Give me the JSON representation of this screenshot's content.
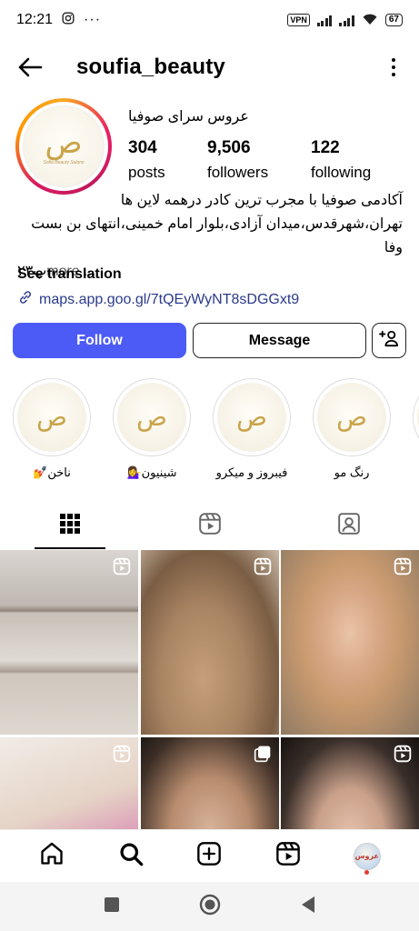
{
  "status_bar": {
    "time": "12:21",
    "vpn": "VPN",
    "battery": "67",
    "dots": "···"
  },
  "header": {
    "username": "soufia_beauty"
  },
  "profile": {
    "display_name": "عروس سرای صوفیا",
    "logo_text": "Sofia Beauty Salons",
    "stats": [
      {
        "value": "304",
        "label": "posts"
      },
      {
        "value": "9,506",
        "label": "followers"
      },
      {
        "value": "122",
        "label": "following"
      }
    ],
    "bio_line1": "آکادمی صوفیا با مجرب ترین کادر درهمه لاین ها",
    "bio_line2": "تهران،شهرقدس،میدان آزادی،بلوار امام خمینی،انتهای بن بست وفا",
    "bio_line3": "پ۲۳",
    "bio_more": "more ...",
    "see_translation": "See translation",
    "link": "maps.app.goo.gl/7tQEyWyNT8sDGGxt9"
  },
  "actions": {
    "follow": "Follow",
    "message": "Message"
  },
  "highlights": [
    {
      "label": "ناخن💅"
    },
    {
      "label": "شینیون💁‍♀️"
    },
    {
      "label": "فیبروز و میکرو"
    },
    {
      "label": "رنگ مو"
    }
  ],
  "colors": {
    "follow_button": "#4c5bf5",
    "link": "#2a3a8c",
    "notification_dot": "#e53935"
  },
  "nav_avatar_text": "عروس"
}
